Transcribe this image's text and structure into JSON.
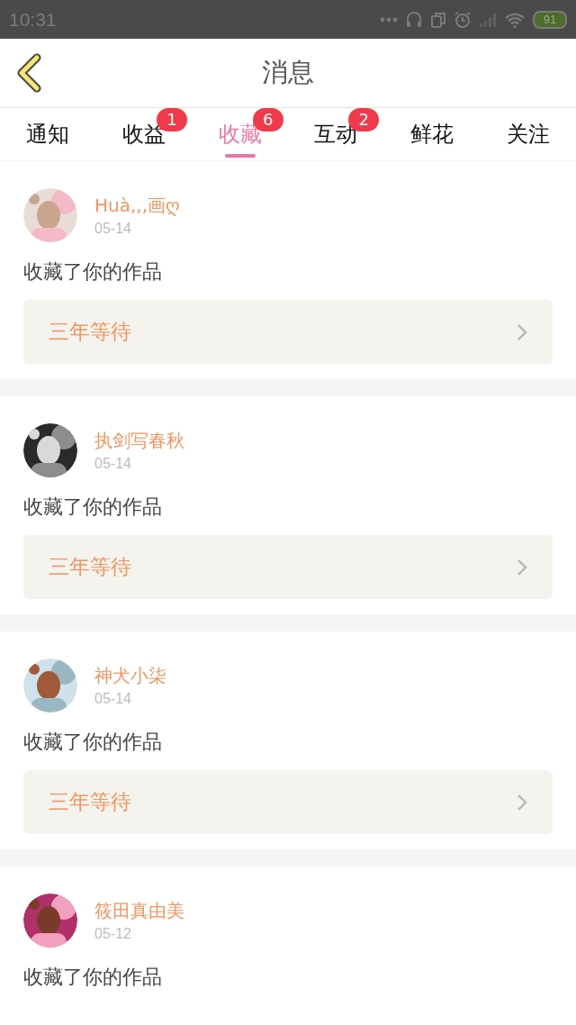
{
  "status_bar": {
    "time": "10:31",
    "battery": "91"
  },
  "header": {
    "title": "消息"
  },
  "tabs": [
    {
      "label": "通知",
      "selected": false
    },
    {
      "label": "收益",
      "selected": false,
      "badge": "1"
    },
    {
      "label": "收藏",
      "selected": true,
      "badge": "6"
    },
    {
      "label": "互动",
      "selected": false,
      "badge": "2"
    },
    {
      "label": "鲜花",
      "selected": false
    },
    {
      "label": "关注",
      "selected": false
    }
  ],
  "messages": [
    {
      "user": "Huà,,,画ღ",
      "date": "05-14",
      "text": "收藏了你的作品",
      "work": "三年等待"
    },
    {
      "user": "执剑写春秋",
      "date": "05-14",
      "text": "收藏了你的作品",
      "work": "三年等待"
    },
    {
      "user": "神犬小柒",
      "date": "05-14",
      "text": "收藏了你的作品",
      "work": "三年等待"
    },
    {
      "user": "筱田真由美",
      "date": "05-12",
      "text": "收藏了你的作品"
    }
  ]
}
